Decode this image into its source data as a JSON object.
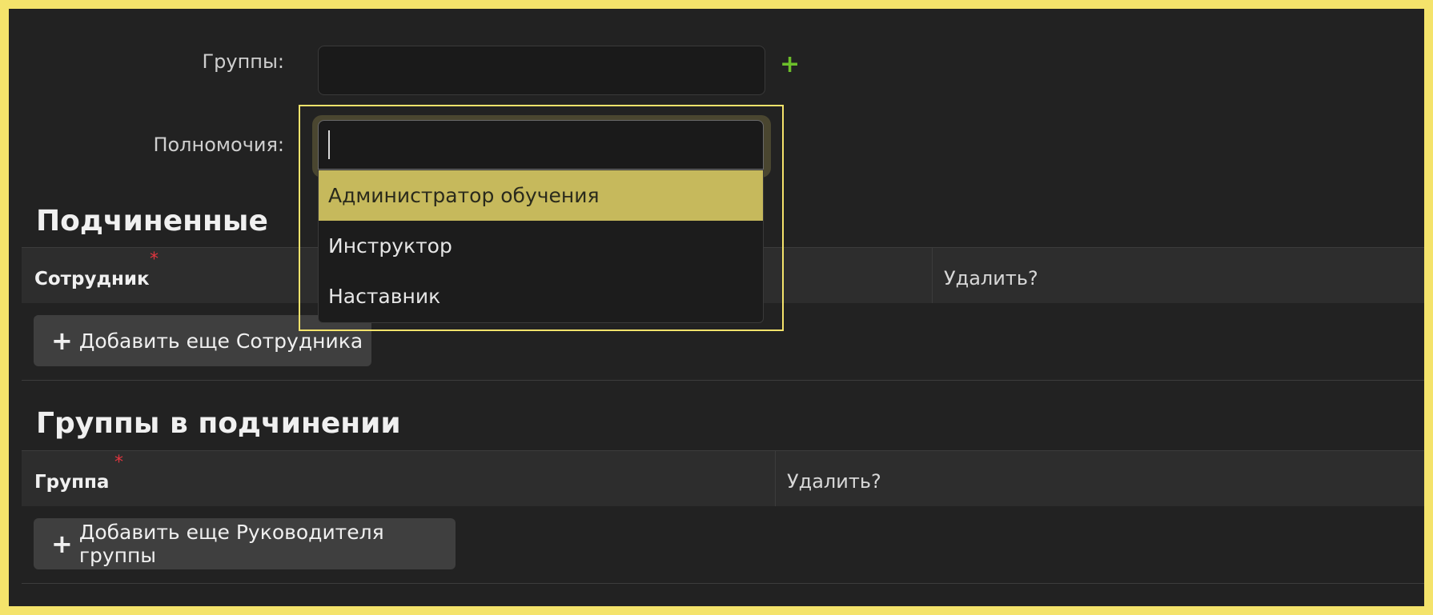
{
  "form": {
    "groups_label": "Группы:",
    "groups_value": "",
    "permissions_label": "Полномочия:",
    "permissions_value": ""
  },
  "dropdown": {
    "options": [
      {
        "label": "Администратор обучения",
        "highlighted": true
      },
      {
        "label": "Инструктор",
        "highlighted": false
      },
      {
        "label": "Наставник",
        "highlighted": false
      }
    ]
  },
  "subordinates": {
    "title": "Подчиненные",
    "col_employee": "Сотрудник",
    "col_delete": "Удалить?",
    "required_mark": "*",
    "add_button": "Добавить еще Сотрудника"
  },
  "group_subordination": {
    "title": "Группы в подчинении",
    "col_group": "Группа",
    "col_delete": "Удалить?",
    "required_mark": "*",
    "add_button": "Добавить еще Руководителя группы"
  },
  "colors": {
    "frame_highlight": "#f4e36b",
    "option_highlight": "#c6b95c",
    "add_icon": "#6cbf2a",
    "required": "#e0353f"
  },
  "icons": {
    "add_group": "plus-icon",
    "add_row": "plus-icon"
  }
}
